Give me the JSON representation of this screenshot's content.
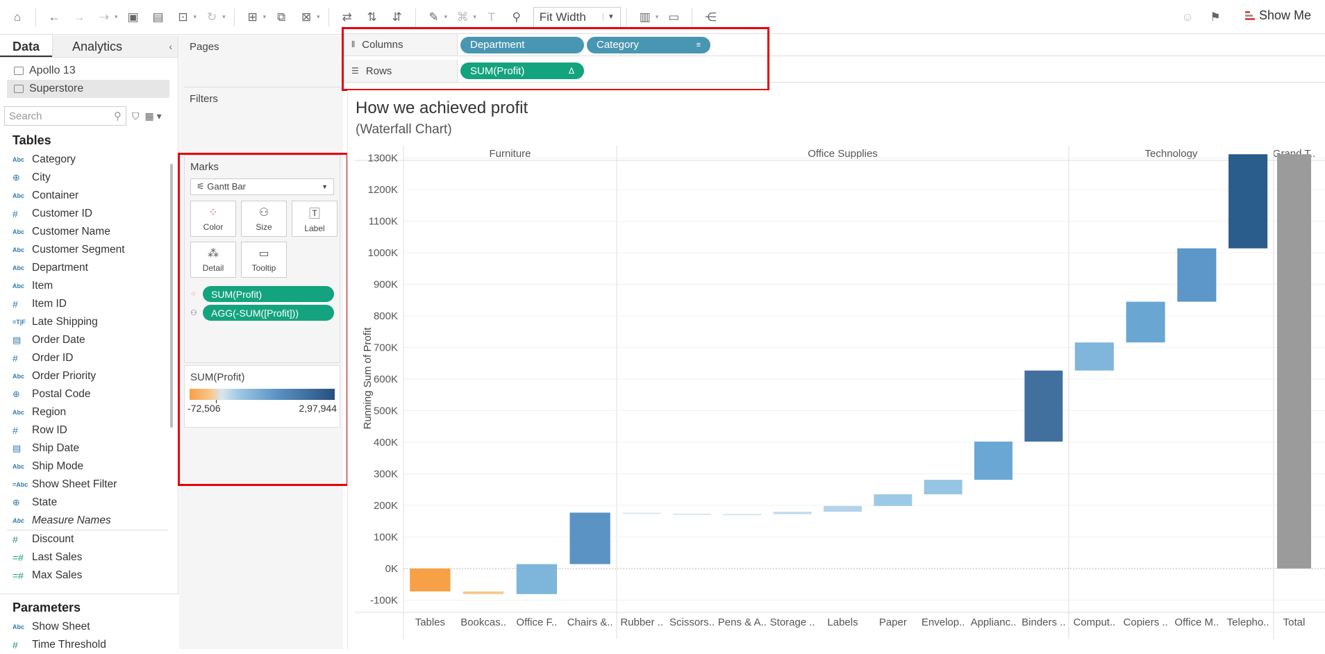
{
  "toolbar": {
    "fit": "Fit Width",
    "show_me": "Show Me"
  },
  "data_pane": {
    "tabs": {
      "data": "Data",
      "analytics": "Analytics"
    },
    "datasources": [
      "Apollo 13",
      "Superstore"
    ],
    "search_placeholder": "Search",
    "tables_header": "Tables",
    "fields": [
      {
        "type": "Abc",
        "name": "Category"
      },
      {
        "type": "globe",
        "name": "City"
      },
      {
        "type": "Abc",
        "name": "Container"
      },
      {
        "type": "#",
        "name": "Customer ID"
      },
      {
        "type": "Abc",
        "name": "Customer Name"
      },
      {
        "type": "Abc",
        "name": "Customer Segment"
      },
      {
        "type": "Abc",
        "name": "Department"
      },
      {
        "type": "Abc",
        "name": "Item"
      },
      {
        "type": "#",
        "name": "Item ID"
      },
      {
        "type": "=T|F",
        "name": "Late Shipping"
      },
      {
        "type": "cal",
        "name": "Order Date"
      },
      {
        "type": "#",
        "name": "Order ID"
      },
      {
        "type": "Abc",
        "name": "Order Priority"
      },
      {
        "type": "globe",
        "name": "Postal Code"
      },
      {
        "type": "Abc",
        "name": "Region"
      },
      {
        "type": "#",
        "name": "Row ID"
      },
      {
        "type": "cal",
        "name": "Ship Date"
      },
      {
        "type": "Abc",
        "name": "Ship Mode"
      },
      {
        "type": "=Abc",
        "name": "Show Sheet Filter"
      },
      {
        "type": "globe",
        "name": "State"
      },
      {
        "type": "Abc",
        "name": "Measure Names"
      },
      {
        "type": "#",
        "name": "Discount"
      },
      {
        "type": "=#",
        "name": "Last Sales"
      },
      {
        "type": "=#",
        "name": "Max Sales"
      }
    ],
    "parameters_header": "Parameters",
    "parameters": [
      {
        "type": "Abc",
        "name": "Show Sheet"
      },
      {
        "type": "#",
        "name": "Time Threshold"
      }
    ]
  },
  "cards": {
    "pages": "Pages",
    "filters": "Filters",
    "marks": "Marks",
    "mark_type": "Gantt Bar",
    "mark_buttons": [
      "Color",
      "Size",
      "Label",
      "Detail",
      "Tooltip"
    ],
    "mark_pills": [
      "SUM(Profit)",
      "AGG(-SUM([Profit]))"
    ],
    "legend_title": "SUM(Profit)",
    "legend_min": "-72,506",
    "legend_max": "2,97,944"
  },
  "shelves": {
    "columns_label": "Columns",
    "rows_label": "Rows",
    "columns_pills": [
      "Department",
      "Category"
    ],
    "rows_pills": [
      "SUM(Profit)"
    ]
  },
  "view": {
    "title": "How we achieved profit",
    "subtitle": "(Waterfall Chart)"
  },
  "chart_data": {
    "type": "bar",
    "subtype": "waterfall",
    "ylabel": "Running Sum of Profit",
    "ylim": [
      -130000,
      1330000
    ],
    "yticks": [
      "1300K",
      "1200K",
      "1100K",
      "1000K",
      "900K",
      "800K",
      "700K",
      "600K",
      "500K",
      "400K",
      "300K",
      "200K",
      "100K",
      "0K",
      "-100K"
    ],
    "ytick_values": [
      1300000,
      1200000,
      1100000,
      1000000,
      900000,
      800000,
      700000,
      600000,
      500000,
      400000,
      300000,
      200000,
      100000,
      0,
      -100000
    ],
    "departments": [
      {
        "name": "Furniture",
        "count": 4
      },
      {
        "name": "Office Supplies",
        "count": 9
      },
      {
        "name": "Technology",
        "count": 4
      },
      {
        "name": "Grand T..",
        "count": 1
      }
    ],
    "categories": [
      "Tables",
      "Bookcas..",
      "Office F..",
      "Chairs &..",
      "Rubber ..",
      "Scissors..",
      "Pens & A..",
      "Storage ..",
      "Labels",
      "Paper",
      "Envelop..",
      "Applianc..",
      "Binders ..",
      "Comput..",
      "Copiers ..",
      "Office M..",
      "Telepho..",
      "Total"
    ],
    "bars": [
      {
        "start": 0,
        "end": -72506,
        "color": "#f7a046"
      },
      {
        "start": -72506,
        "end": -81000,
        "color": "#f6c98f"
      },
      {
        "start": -81000,
        "end": 14000,
        "color": "#7eb6db"
      },
      {
        "start": 14000,
        "end": 177000,
        "color": "#5b93c4"
      },
      {
        "start": 177000,
        "end": 174000,
        "color": "#d9e6ee"
      },
      {
        "start": 174000,
        "end": 173000,
        "color": "#d9e6ee"
      },
      {
        "start": 173000,
        "end": 172000,
        "color": "#d9e6ee"
      },
      {
        "start": 172000,
        "end": 180000,
        "color": "#c4dced"
      },
      {
        "start": 180000,
        "end": 198000,
        "color": "#b3d3ea"
      },
      {
        "start": 198000,
        "end": 235000,
        "color": "#9cc9e6"
      },
      {
        "start": 235000,
        "end": 281000,
        "color": "#95c5e3"
      },
      {
        "start": 281000,
        "end": 402000,
        "color": "#6ba7d4"
      },
      {
        "start": 402000,
        "end": 627000,
        "color": "#41709f"
      },
      {
        "start": 627000,
        "end": 716000,
        "color": "#80b5dc"
      },
      {
        "start": 716000,
        "end": 845000,
        "color": "#6aa6d2"
      },
      {
        "start": 845000,
        "end": 1014000,
        "color": "#5d96c8"
      },
      {
        "start": 1014000,
        "end": 1312000,
        "color": "#2a5c8c"
      },
      {
        "start": 0,
        "end": 1312000,
        "color": "#9b9b9b"
      }
    ]
  }
}
